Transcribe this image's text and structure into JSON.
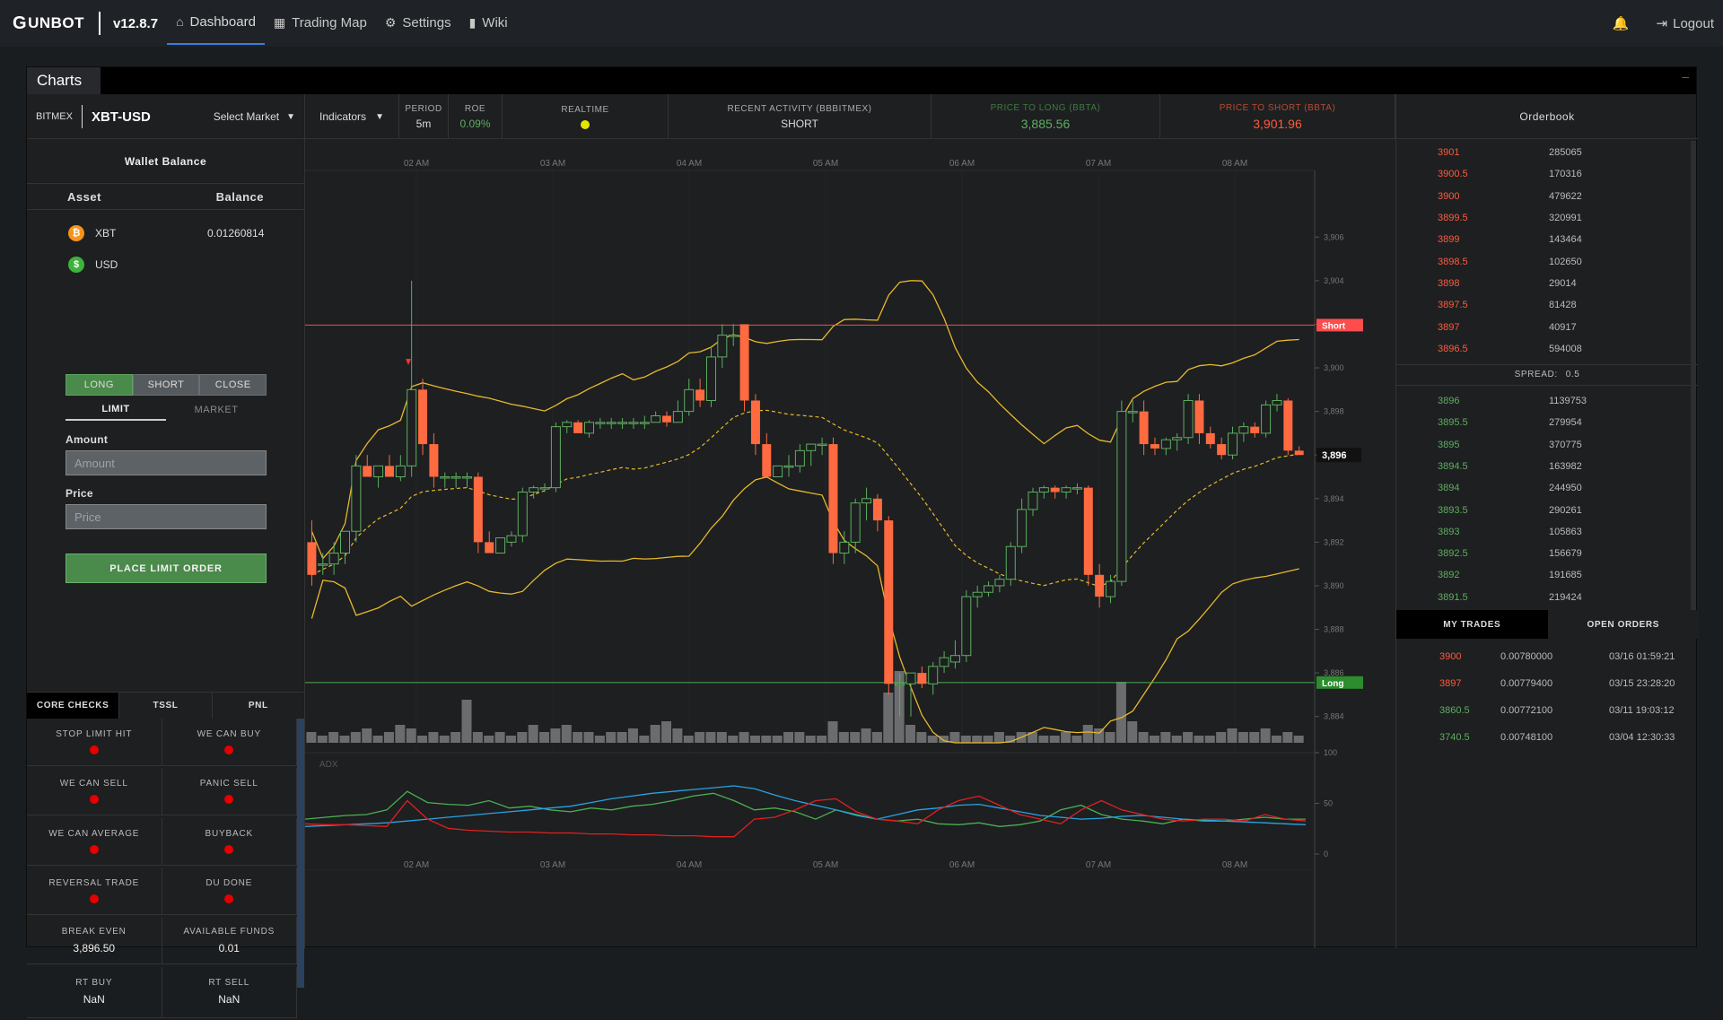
{
  "app": {
    "logo": "UNBOT",
    "version": "v12.8.7"
  },
  "nav": [
    {
      "label": "Dashboard",
      "icon": "home-icon"
    },
    {
      "label": "Trading Map",
      "icon": "grid-icon"
    },
    {
      "label": "Settings",
      "icon": "gear-icon"
    },
    {
      "label": "Wiki",
      "icon": "book-icon"
    }
  ],
  "topright": {
    "logout": "Logout"
  },
  "panel": {
    "title": "Charts"
  },
  "market": {
    "exchange": "BITMEX",
    "pair": "XBT-USD",
    "select_market": "Select Market",
    "indicators": "Indicators",
    "period_label": "PERIOD",
    "period": "5m",
    "roe_label": "ROE",
    "roe": "0.09%",
    "realtime_label": "REALTIME",
    "activity_label": "RECENT ACTIVITY (BBBITMEX)",
    "activity": "SHORT",
    "long_label": "PRICE TO LONG (BBTA)",
    "long_price": "3,885.56",
    "short_label": "PRICE TO SHORT (BBTA)",
    "short_price": "3,901.96"
  },
  "wallet": {
    "title": "Wallet Balance",
    "asset_header": "Asset",
    "balance_header": "Balance",
    "assets": [
      {
        "symbol": "XBT",
        "balance": "0.01260814",
        "color": "#f7931a",
        "glyph": "₿"
      },
      {
        "symbol": "USD",
        "balance": "",
        "color": "#3cb43c",
        "glyph": "$"
      }
    ]
  },
  "order": {
    "long": "LONG",
    "short": "SHORT",
    "close": "CLOSE",
    "limit": "LIMIT",
    "market": "MARKET",
    "amount_label": "Amount",
    "amount_placeholder": "Amount",
    "price_label": "Price",
    "price_placeholder": "Price",
    "place": "PLACE LIMIT ORDER"
  },
  "checks": {
    "tabs": [
      "CORE CHECKS",
      "TSSL",
      "PNL"
    ],
    "items": [
      {
        "label": "STOP LIMIT HIT",
        "value": ""
      },
      {
        "label": "WE CAN BUY",
        "value": ""
      },
      {
        "label": "WE CAN SELL",
        "value": ""
      },
      {
        "label": "PANIC SELL",
        "value": ""
      },
      {
        "label": "WE CAN AVERAGE",
        "value": ""
      },
      {
        "label": "BUYBACK",
        "value": ""
      },
      {
        "label": "REVERSAL TRADE",
        "value": ""
      },
      {
        "label": "DU DONE",
        "value": ""
      },
      {
        "label": "BREAK EVEN",
        "value": "3,896.50"
      },
      {
        "label": "AVAILABLE FUNDS",
        "value": "0.01"
      },
      {
        "label": "RT BUY",
        "value": "NaN"
      },
      {
        "label": "RT SELL",
        "value": "NaN"
      }
    ]
  },
  "chart": {
    "time_labels": [
      "02 AM",
      "03 AM",
      "04 AM",
      "05 AM",
      "06 AM",
      "07 AM",
      "08 AM"
    ],
    "price_ticks": [
      "3,906",
      "3,904",
      "3,902",
      "3,900",
      "3,898",
      "3,896",
      "3,894",
      "3,892",
      "3,890",
      "3,888",
      "3,886",
      "3,884"
    ],
    "short_label": "Short",
    "long_label": "Long",
    "current_price": "3,896",
    "adx_label": "ADX",
    "adx_ticks": [
      "100",
      "50",
      "0"
    ],
    "colors": {
      "up": "#5fae5f",
      "down": "#ff6a40",
      "band": "#e8b82a",
      "short": "#ff4d4d",
      "long": "#4caf50"
    }
  },
  "chart_data": [
    {
      "type": "candlestick",
      "xlabel": "",
      "ylabel": "",
      "ylim": [
        3883,
        3907
      ],
      "short_line": 3901.96,
      "long_line": 3885.56,
      "last_price": 3896,
      "ohlc": [
        [
          3892,
          3893,
          3890,
          3890.5
        ],
        [
          3891,
          3891.5,
          3890.5,
          3891
        ],
        [
          3891,
          3892,
          3890.5,
          3891.5
        ],
        [
          3891.5,
          3892.5,
          3891,
          3892.5
        ],
        [
          3892.5,
          3896,
          3892,
          3895.5
        ],
        [
          3895.5,
          3896,
          3895,
          3895
        ],
        [
          3895,
          3895.5,
          3894.5,
          3895.5
        ],
        [
          3895.5,
          3896,
          3895,
          3895
        ],
        [
          3895,
          3896,
          3894.8,
          3895.5
        ],
        [
          3895.5,
          3904,
          3895,
          3899
        ],
        [
          3899,
          3899.5,
          3896,
          3896.5
        ],
        [
          3896.5,
          3897,
          3894.5,
          3895
        ],
        [
          3895,
          3895.2,
          3894.5,
          3895
        ],
        [
          3895,
          3895.2,
          3894.5,
          3895
        ],
        [
          3895,
          3895.2,
          3894.5,
          3895
        ],
        [
          3895,
          3895.2,
          3891.5,
          3892
        ],
        [
          3892,
          3892.5,
          3891.5,
          3891.5
        ],
        [
          3891.5,
          3892.2,
          3891.5,
          3892.2
        ],
        [
          3892,
          3892.5,
          3891.8,
          3892.3
        ],
        [
          3892.3,
          3894.5,
          3892,
          3894.3
        ],
        [
          3894.3,
          3894.6,
          3894,
          3894.5
        ],
        [
          3894.5,
          3894.7,
          3894.3,
          3894.5
        ],
        [
          3894.5,
          3897.5,
          3894.3,
          3897.3
        ],
        [
          3897.3,
          3897.6,
          3897,
          3897.5
        ],
        [
          3897.5,
          3897.6,
          3897,
          3897
        ],
        [
          3897,
          3897.6,
          3896.8,
          3897.5
        ],
        [
          3897.5,
          3897.7,
          3897.2,
          3897.5
        ],
        [
          3897.5,
          3897.7,
          3897.2,
          3897.5
        ],
        [
          3897.5,
          3897.7,
          3897.2,
          3897.5
        ],
        [
          3897.5,
          3897.7,
          3897.2,
          3897.5
        ],
        [
          3897.5,
          3897.8,
          3897.2,
          3897.5
        ],
        [
          3897.5,
          3898,
          3897.5,
          3897.8
        ],
        [
          3897.8,
          3898,
          3897.3,
          3897.5
        ],
        [
          3897.5,
          3898.5,
          3897.5,
          3898
        ],
        [
          3898,
          3899.5,
          3897.8,
          3899
        ],
        [
          3899,
          3899.5,
          3898.2,
          3898.5
        ],
        [
          3898.5,
          3901,
          3898.2,
          3900.5
        ],
        [
          3900.5,
          3902,
          3900,
          3901.5
        ],
        [
          3901.5,
          3902,
          3901,
          3901.5
        ],
        [
          3902,
          3902,
          3898,
          3898.5
        ],
        [
          3898.5,
          3898.8,
          3896,
          3896.5
        ],
        [
          3896.5,
          3897,
          3895,
          3895
        ],
        [
          3895,
          3895.5,
          3895,
          3895.5
        ],
        [
          3895.5,
          3896,
          3895,
          3895.5
        ],
        [
          3895.5,
          3896.5,
          3895.2,
          3896.2
        ],
        [
          3896.2,
          3896.5,
          3895.5,
          3896.5
        ],
        [
          3896.5,
          3896.8,
          3896,
          3896.5
        ],
        [
          3896.5,
          3896.8,
          3891,
          3891.5
        ],
        [
          3891.5,
          3892.5,
          3891,
          3892
        ],
        [
          3892,
          3894,
          3891.5,
          3893.8
        ],
        [
          3893.8,
          3894.5,
          3893,
          3894
        ],
        [
          3894,
          3894.2,
          3892.5,
          3893
        ],
        [
          3893,
          3893.2,
          3885,
          3885.5
        ],
        [
          3885.5,
          3886,
          3884,
          3885.5
        ],
        [
          3885.5,
          3886,
          3884,
          3886
        ],
        [
          3886,
          3886.3,
          3885.3,
          3885.5
        ],
        [
          3885.5,
          3886.5,
          3885,
          3886.3
        ],
        [
          3886.3,
          3887,
          3886,
          3886.7
        ],
        [
          3886.5,
          3887.5,
          3886.2,
          3886.8
        ],
        [
          3886.8,
          3889.8,
          3886.5,
          3889.5
        ],
        [
          3889.5,
          3890,
          3889,
          3889.7
        ],
        [
          3889.7,
          3890.2,
          3889.5,
          3890
        ],
        [
          3890,
          3890.5,
          3889.7,
          3890.3
        ],
        [
          3890.3,
          3892,
          3890,
          3891.8
        ],
        [
          3891.8,
          3894,
          3891.5,
          3893.5
        ],
        [
          3893.5,
          3894.5,
          3893.2,
          3894.3
        ],
        [
          3894.3,
          3894.6,
          3894,
          3894.5
        ],
        [
          3894.5,
          3894.6,
          3894,
          3894.3
        ],
        [
          3894.3,
          3894.6,
          3894,
          3894.5
        ],
        [
          3894.5,
          3894.7,
          3894.2,
          3894.5
        ],
        [
          3894.5,
          3894.6,
          3890,
          3890.5
        ],
        [
          3890.5,
          3891,
          3889,
          3889.5
        ],
        [
          3889.5,
          3890.5,
          3889.2,
          3890.2
        ],
        [
          3890.2,
          3898.5,
          3890,
          3898
        ],
        [
          3898,
          3898.5,
          3897.5,
          3898
        ],
        [
          3898,
          3898.5,
          3896,
          3896.5
        ],
        [
          3896.5,
          3896.8,
          3896,
          3896.3
        ],
        [
          3896.3,
          3896.8,
          3896,
          3896.7
        ],
        [
          3896.7,
          3897,
          3896.2,
          3896.8
        ],
        [
          3896.8,
          3898.8,
          3896.5,
          3898.5
        ],
        [
          3898.5,
          3898.8,
          3896.5,
          3897
        ],
        [
          3897,
          3897.3,
          3896.3,
          3896.5
        ],
        [
          3896.5,
          3896.8,
          3895.8,
          3896
        ],
        [
          3896,
          3897.3,
          3895.8,
          3897
        ],
        [
          3897,
          3897.5,
          3896.6,
          3897.3
        ],
        [
          3897.3,
          3897.5,
          3896.8,
          3897
        ],
        [
          3897,
          3898.5,
          3896.8,
          3898.3
        ],
        [
          3898.3,
          3898.8,
          3898,
          3898.5
        ],
        [
          3898.5,
          3898.6,
          3896,
          3896.2
        ],
        [
          3896.2,
          3896.4,
          3896,
          3896
        ]
      ],
      "volume": [
        3,
        2,
        3,
        2,
        3,
        4,
        2,
        3,
        5,
        4,
        2,
        3,
        2,
        3,
        12,
        3,
        2,
        3,
        2,
        3,
        5,
        3,
        4,
        5,
        3,
        3,
        2,
        3,
        3,
        4,
        2,
        5,
        6,
        4,
        2,
        3,
        3,
        3,
        2,
        3,
        2,
        2,
        2,
        3,
        3,
        2,
        2,
        6,
        3,
        3,
        4,
        3,
        14,
        20,
        5,
        3,
        2,
        2,
        3,
        2,
        2,
        2,
        3,
        2,
        3,
        3,
        2,
        2,
        3,
        2,
        5,
        4,
        3,
        17,
        6,
        3,
        2,
        3,
        2,
        3,
        2,
        2,
        3,
        4,
        3,
        3,
        4,
        2,
        3,
        2
      ],
      "volume_highlight": {
        "9": 16,
        "72": 17
      }
    },
    {
      "type": "line",
      "title": "ADX",
      "ylim": [
        0,
        100
      ],
      "series": [
        {
          "color": "#4caf50",
          "values": [
            30,
            32,
            34,
            35,
            40,
            60,
            48,
            46,
            45,
            50,
            42,
            44,
            40,
            38,
            42,
            40,
            44,
            46,
            50,
            55,
            58,
            50,
            40,
            42,
            38,
            30,
            40,
            35,
            30,
            28,
            30,
            25,
            24,
            26,
            22,
            24,
            28,
            40,
            45,
            35,
            30,
            28,
            25,
            30,
            28,
            28,
            30,
            32,
            30,
            30
          ]
        },
        {
          "color": "#29a3e0",
          "values": [
            22,
            23,
            24,
            25,
            26,
            28,
            30,
            32,
            34,
            36,
            38,
            40,
            42,
            44,
            48,
            52,
            55,
            58,
            60,
            62,
            64,
            66,
            63,
            56,
            50,
            45,
            40,
            34,
            30,
            35,
            40,
            42,
            45,
            46,
            42,
            38,
            34,
            32,
            30,
            31,
            33,
            34,
            32,
            30,
            29,
            28,
            27,
            26,
            25,
            24
          ]
        },
        {
          "color": "#e02020",
          "values": [
            25,
            24,
            24,
            23,
            22,
            50,
            30,
            20,
            18,
            17,
            16,
            16,
            15,
            15,
            14,
            14,
            13,
            13,
            12,
            12,
            11,
            11,
            30,
            32,
            40,
            50,
            52,
            38,
            30,
            28,
            25,
            40,
            50,
            55,
            45,
            35,
            30,
            25,
            40,
            50,
            40,
            35,
            30,
            28,
            30,
            30,
            28,
            35,
            30,
            28
          ]
        }
      ]
    }
  ],
  "orderbook": {
    "title": "Orderbook",
    "asks": [
      [
        "3901",
        "285065"
      ],
      [
        "3900.5",
        "170316"
      ],
      [
        "3900",
        "479622"
      ],
      [
        "3899.5",
        "320991"
      ],
      [
        "3899",
        "143464"
      ],
      [
        "3898.5",
        "102650"
      ],
      [
        "3898",
        "29014"
      ],
      [
        "3897.5",
        "81428"
      ],
      [
        "3897",
        "40917"
      ],
      [
        "3896.5",
        "594008"
      ]
    ],
    "spread_label": "SPREAD:",
    "spread": "0.5",
    "bids": [
      [
        "3896",
        "1139753"
      ],
      [
        "3895.5",
        "279954"
      ],
      [
        "3895",
        "370775"
      ],
      [
        "3894.5",
        "163982"
      ],
      [
        "3894",
        "244950"
      ],
      [
        "3893.5",
        "290261"
      ],
      [
        "3893",
        "105863"
      ],
      [
        "3892.5",
        "156679"
      ],
      [
        "3892",
        "191685"
      ],
      [
        "3891.5",
        "219424"
      ]
    ],
    "trade_tabs": [
      "MY TRADES",
      "OPEN ORDERS"
    ],
    "trades": [
      {
        "price": "3900",
        "size": "0.00780000",
        "time": "03/16 01:59:21",
        "side": "sell"
      },
      {
        "price": "3897",
        "size": "0.00779400",
        "time": "03/15 23:28:20",
        "side": "sell"
      },
      {
        "price": "3860.5",
        "size": "0.00772100",
        "time": "03/11 19:03:12",
        "side": "buy"
      },
      {
        "price": "3740.5",
        "size": "0.00748100",
        "time": "03/04 12:30:33",
        "side": "buy"
      }
    ]
  }
}
